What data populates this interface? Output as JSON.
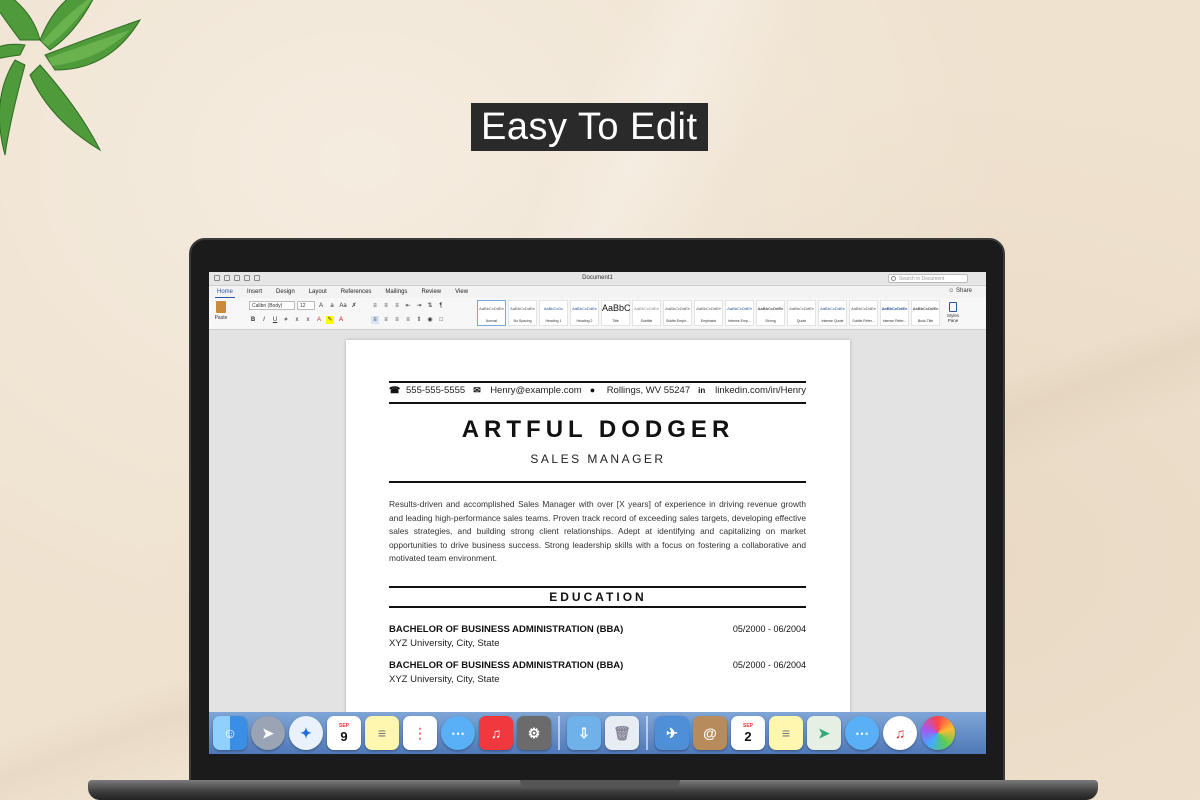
{
  "headline": "Easy To Edit",
  "word": {
    "doc_title": "Document1",
    "search_placeholder": "Search in Document",
    "tabs": [
      "Home",
      "Insert",
      "Design",
      "Layout",
      "References",
      "Mailings",
      "Review",
      "View"
    ],
    "share_label": "Share",
    "paste_label": "Paste",
    "font_name": "Calibri (Body)",
    "font_size": "12",
    "styles": [
      {
        "sample": "AaBbCcDdEe",
        "name": "Normal"
      },
      {
        "sample": "AaBbCcDdEe",
        "name": "No Spacing"
      },
      {
        "sample": "AaBbCcDc",
        "name": "Heading 1"
      },
      {
        "sample": "AaBbCcDdEe",
        "name": "Heading 2"
      },
      {
        "sample": "AaBbC",
        "name": "Title"
      },
      {
        "sample": "AaBbCcDdEe",
        "name": "Subtitle"
      },
      {
        "sample": "AaBbCcDdEe",
        "name": "Subtle Emph..."
      },
      {
        "sample": "AaBbCcDdEe",
        "name": "Emphasis"
      },
      {
        "sample": "AaBbCcDdEe",
        "name": "Intense Emp..."
      },
      {
        "sample": "AaBbCcDdEe",
        "name": "Strong"
      },
      {
        "sample": "AaBbCcDdEe",
        "name": "Quote"
      },
      {
        "sample": "AaBbCcDdEe",
        "name": "Intense Quote"
      },
      {
        "sample": "AaBbCcDdEe",
        "name": "Subtle Refer..."
      },
      {
        "sample": "AaBbCcDdEe",
        "name": "Intense Refer..."
      },
      {
        "sample": "AaBbCcDdEe",
        "name": "Book Title"
      }
    ],
    "styles_pane_label": "Styles Pane"
  },
  "resume": {
    "phone": "555-555-5555",
    "email": "Henry@example.com",
    "location": "Rollings, WV 55247",
    "linkedin": "linkedin.com/in/Henry",
    "name": "ARTFUL DODGER",
    "role": "SALES MANAGER",
    "summary": "Results-driven and accomplished Sales Manager with over [X years] of experience in driving revenue growth and leading high-performance sales teams. Proven track record of exceeding sales targets, developing effective sales strategies, and building strong client relationships. Adept at identifying and capitalizing on market opportunities to drive business success. Strong leadership skills with a focus on fostering a collaborative and motivated team environment.",
    "education_title": "EDUCATION",
    "education": [
      {
        "degree": "BACHELOR OF BUSINESS ADMINISTRATION (BBA)",
        "dates": "05/2000 - 06/2004",
        "school": "XYZ University, City, State"
      },
      {
        "degree": "BACHELOR OF BUSINESS ADMINISTRATION (BBA)",
        "dates": "05/2000 - 06/2004",
        "school": "XYZ University, City, State"
      }
    ]
  },
  "dock": {
    "calendar_month": "SEP",
    "calendar_day": "9",
    "calendar_day_2": "2",
    "icons": [
      "finder-icon",
      "launchpad-icon",
      "safari-icon",
      "calendar-icon",
      "notes-icon",
      "reminders-icon",
      "messages-icon",
      "music-icon",
      "system-preferences-icon",
      "downloads-folder-icon",
      "trash-icon",
      "preview-icon",
      "contacts-icon",
      "calendar-icon",
      "notes-icon",
      "maps-icon",
      "messages-icon",
      "itunes-icon",
      "photos-icon"
    ]
  }
}
